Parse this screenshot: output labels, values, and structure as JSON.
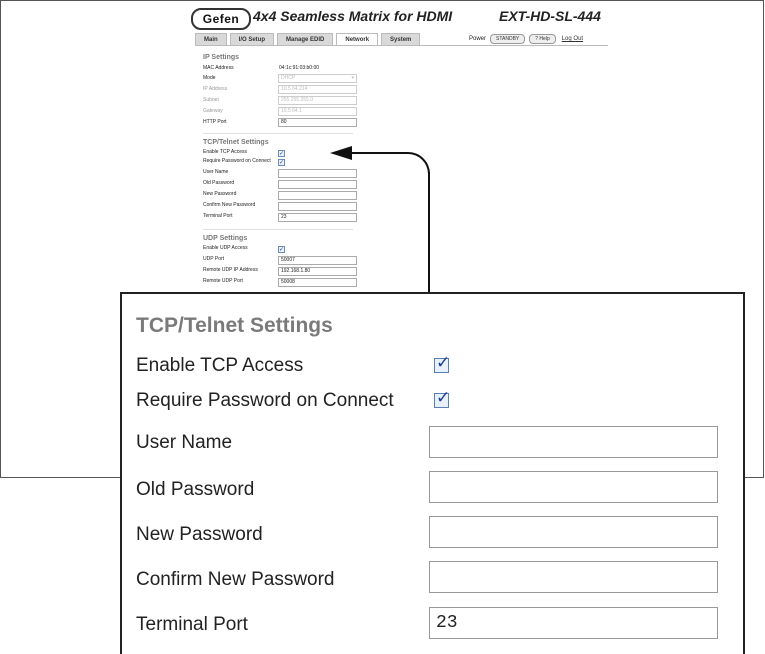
{
  "header": {
    "logo": "Gefen",
    "product_title": "4x4 Seamless Matrix for HDMI",
    "model": "EXT-HD-SL-444"
  },
  "tabs": [
    {
      "label": "Main"
    },
    {
      "label": "I/O Setup"
    },
    {
      "label": "Manage EDID"
    },
    {
      "label": "Network",
      "active": true
    },
    {
      "label": "System"
    }
  ],
  "power": {
    "label": "Power",
    "standby_label": "STANDBY",
    "help_label": "? Help",
    "logout_label": "Log Out"
  },
  "ip_settings": {
    "title": "IP Settings",
    "mac_label": "MAC Address",
    "mac_value": "04:1c:91:03:b0:00",
    "mode_label": "Mode",
    "mode_value": "DHCP",
    "ip_label": "IP Address",
    "ip_value": "10.5.64.214",
    "subnet_label": "Subnet",
    "subnet_value": "255.255.255.0",
    "gateway_label": "Gateway",
    "gateway_value": "10.5.64.1",
    "http_label": "HTTP Port",
    "http_value": "80"
  },
  "tcp_settings": {
    "title": "TCP/Telnet Settings",
    "enable_label": "Enable TCP Access",
    "enable_checked": true,
    "require_label": "Require Password on Connect",
    "require_checked": true,
    "username_label": "User Name",
    "username_value": "",
    "oldpw_label": "Old Password",
    "oldpw_value": "",
    "newpw_label": "New Password",
    "newpw_value": "",
    "confirmpw_label": "Confirm New Password",
    "confirmpw_value": "",
    "terminal_label": "Terminal Port",
    "terminal_value": "23"
  },
  "udp_settings": {
    "title": "UDP Settings",
    "enable_label": "Enable UDP Access",
    "enable_checked": true,
    "port_label": "UDP Port",
    "port_value": "50007",
    "remote_ip_label": "Remote UDP IP Address",
    "remote_ip_value": "192.168.1.80",
    "remote_port_label": "Remote UDP Port",
    "remote_port_value": "50008"
  },
  "colors": {
    "section_title": "#7a7a7a",
    "checkbox_mark": "#1b3f8f"
  }
}
